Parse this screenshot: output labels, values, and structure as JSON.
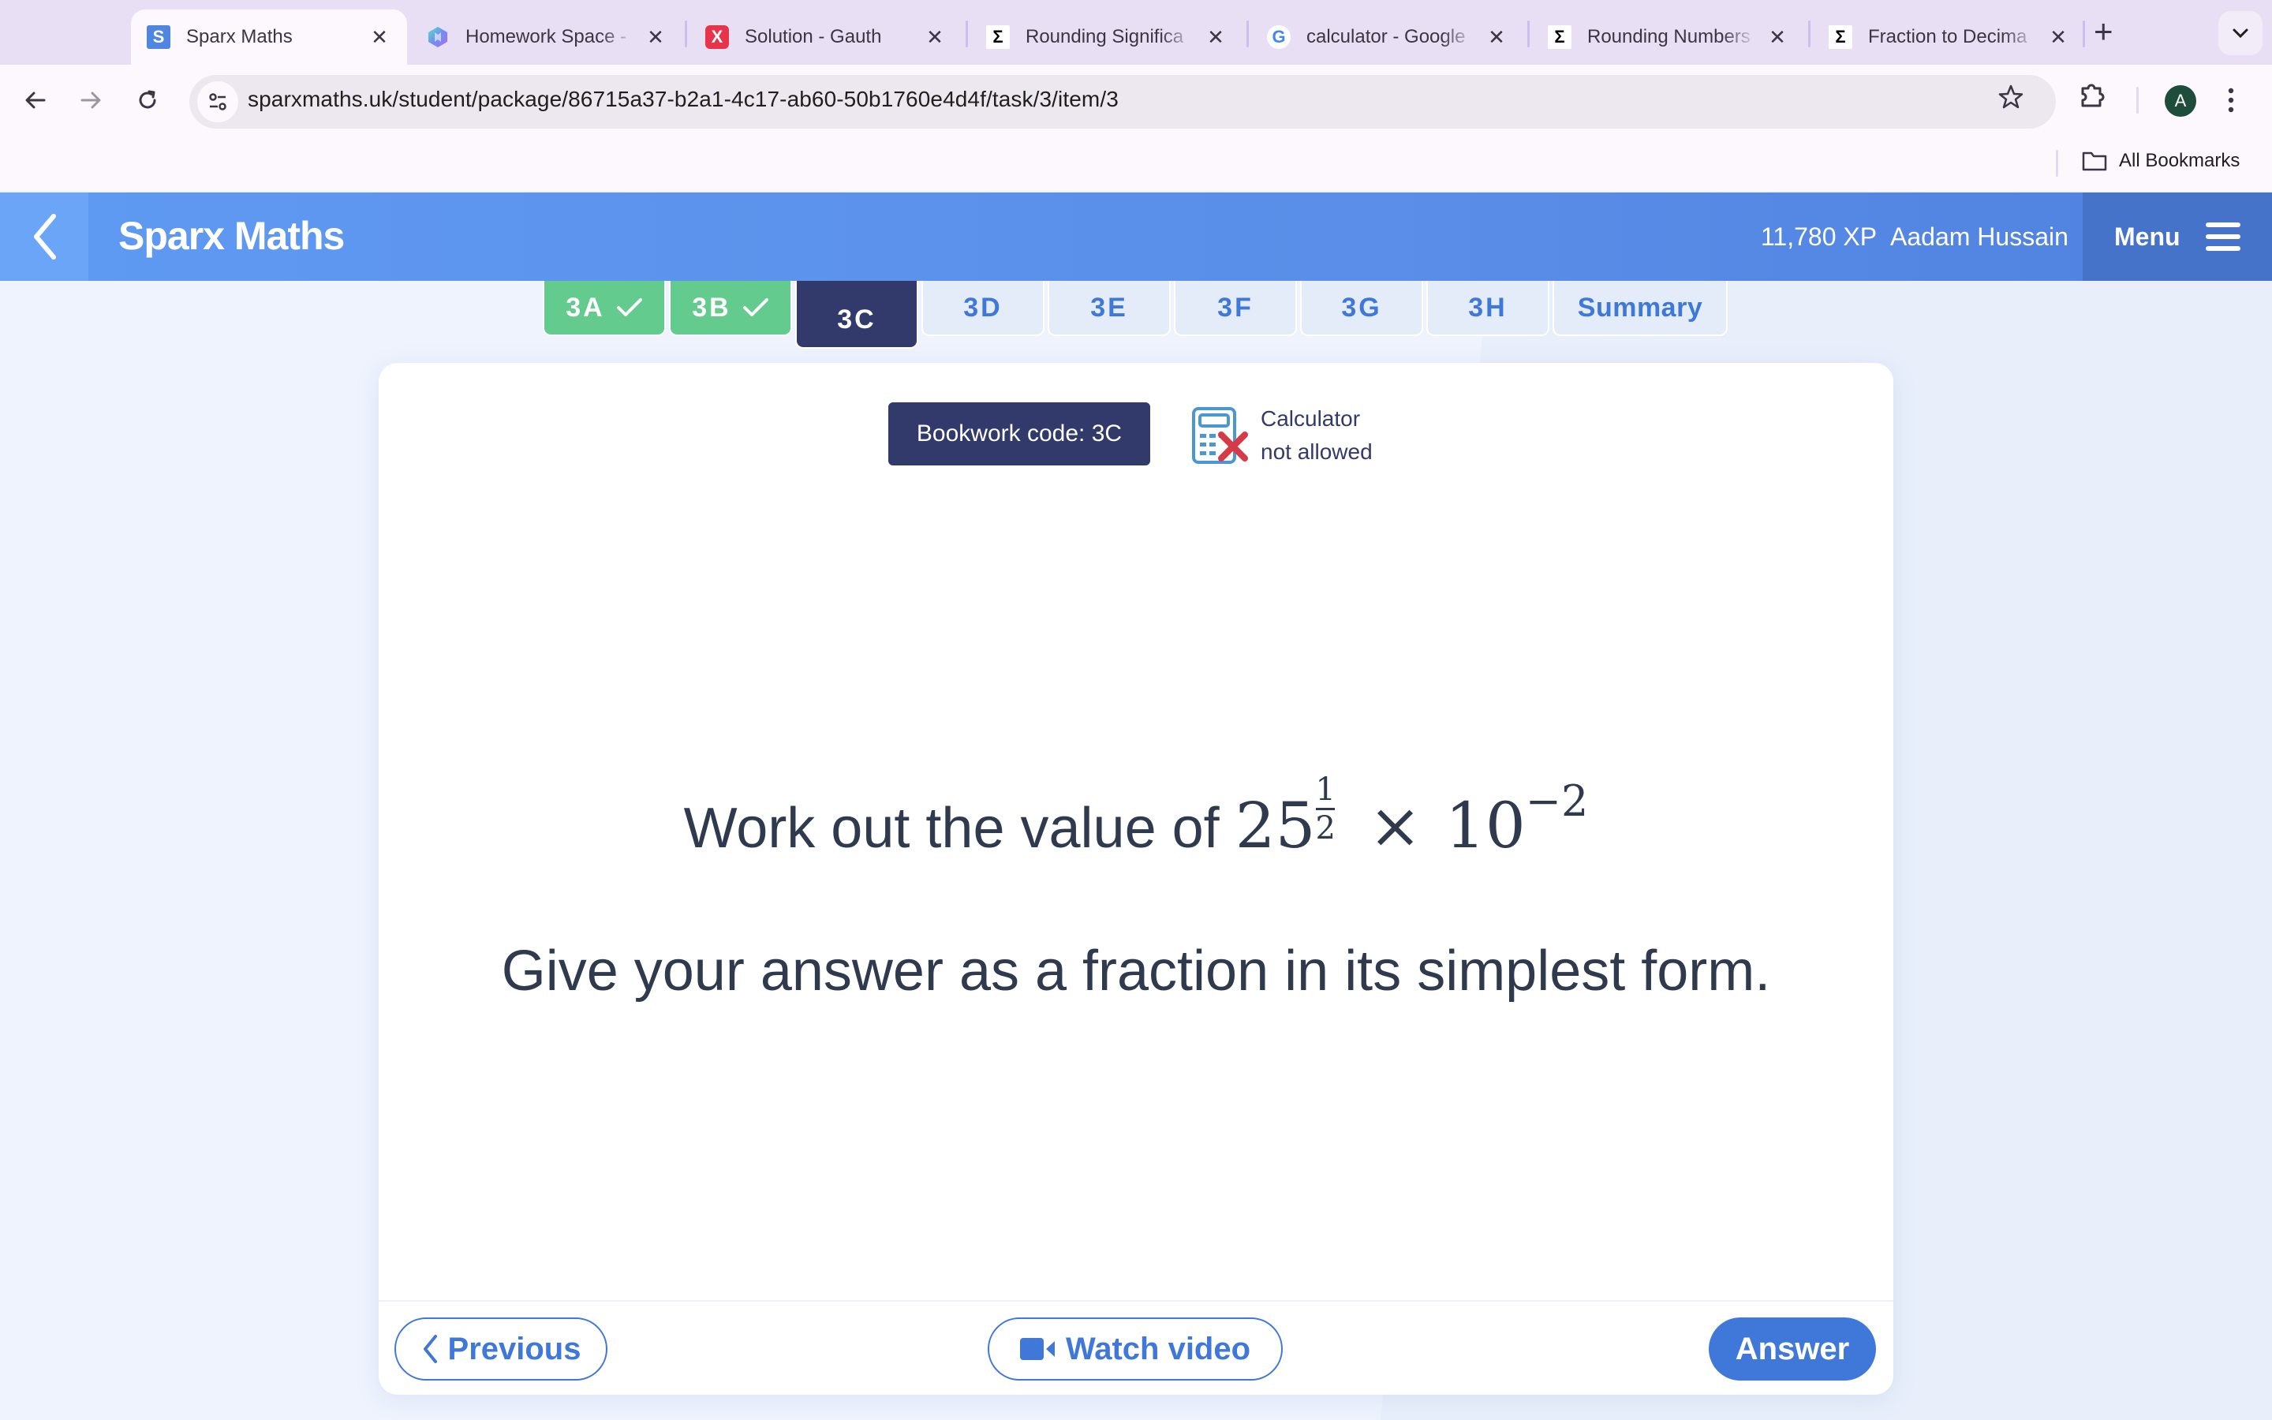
{
  "browser": {
    "tabs": [
      {
        "title": "Sparx Maths",
        "favicon": "sparx-favicon",
        "active": true
      },
      {
        "title": "Homework Space - ",
        "favicon": "homework-space-favicon",
        "active": false
      },
      {
        "title": "Solution - Gauth",
        "favicon": "gauth-favicon",
        "active": false
      },
      {
        "title": "Rounding Significa",
        "favicon": "sigma-favicon",
        "active": false
      },
      {
        "title": "calculator - Google",
        "favicon": "google-favicon",
        "active": false
      },
      {
        "title": "Rounding Numbers",
        "favicon": "sigma-favicon",
        "active": false
      },
      {
        "title": "Fraction to Decima",
        "favicon": "sigma-favicon",
        "active": false
      }
    ],
    "favicon_letters": {
      "sparx": "S",
      "gauth": "X",
      "sigma": "Σ",
      "google": "G"
    },
    "url": "sparxmaths.uk/student/package/86715a37-b2a1-4c17-ab60-50b1760e4d4f/task/3/item/3",
    "profile_initial": "A",
    "bookmarks_label": "All Bookmarks"
  },
  "header": {
    "brand": "Sparx Maths",
    "xp": "11,780 XP",
    "user_name": "Aadam Hussain",
    "menu_label": "Menu"
  },
  "task_tabs": [
    {
      "label": "3A",
      "status": "complete"
    },
    {
      "label": "3B",
      "status": "complete"
    },
    {
      "label": "3C",
      "status": "current"
    },
    {
      "label": "3D",
      "status": "pending"
    },
    {
      "label": "3E",
      "status": "pending"
    },
    {
      "label": "3F",
      "status": "pending"
    },
    {
      "label": "3G",
      "status": "pending"
    },
    {
      "label": "3H",
      "status": "pending"
    },
    {
      "label": "Summary",
      "status": "pending"
    }
  ],
  "question": {
    "bookwork_code": "Bookwork code: 3C",
    "calculator_line1": "Calculator",
    "calculator_line2": "not allowed",
    "prompt": "Work out the value of",
    "base1": "25",
    "exp1_num": "1",
    "exp1_den": "2",
    "operator": "×",
    "base2": "10",
    "exp2": "−2",
    "instruction": "Give your answer as a fraction in its simplest form."
  },
  "actions": {
    "previous": "Previous",
    "watch_video": "Watch video",
    "answer": "Answer"
  },
  "colors": {
    "brand_blue": "#5a8ee8",
    "navy": "#323a6b",
    "complete_green": "#63cb8d",
    "action_blue": "#3f78d9",
    "calc_x_red": "#d63a48"
  }
}
